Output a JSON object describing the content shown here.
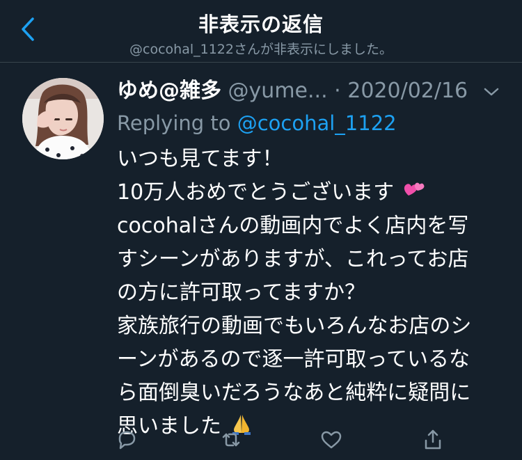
{
  "header": {
    "back_icon": "chevron-left-icon",
    "title": "非表示の返信",
    "subtitle": "@cocohal_1122さんが非表示にしました。"
  },
  "tweet": {
    "display_name": "ゆめ@雑多",
    "handle": "@yume...",
    "separator": " · ",
    "timestamp": "2020/02/16",
    "more_icon": "chevron-down-icon",
    "reply_prefix": "Replying to ",
    "reply_handle": "@cocohal_1122",
    "lines": [
      "いつも見てます！",
      "10万人おめでとうございます",
      "cocohalさんの動画内でよく店内を写",
      "すシーンがありますが、これってお店",
      "の方に許可取ってますか？",
      "家族旅行の動画でもいろんなお店のシ",
      "ーンがあるので逐一許可取っているな",
      "ら面倒臭いだろうなあと純粋に疑問に",
      "思いました"
    ],
    "emojis": {
      "line_2": "two-hearts-emoji",
      "line_9": "folded-hands-emoji"
    }
  },
  "actions": {
    "reply_icon": "reply-icon",
    "retweet_icon": "retweet-icon",
    "like_icon": "heart-icon",
    "share_icon": "share-icon"
  },
  "colors": {
    "background": "#15202b",
    "divider": "#38444d",
    "primary_text": "#ffffff",
    "secondary_text": "#8899a6",
    "accent": "#1da1f2"
  }
}
